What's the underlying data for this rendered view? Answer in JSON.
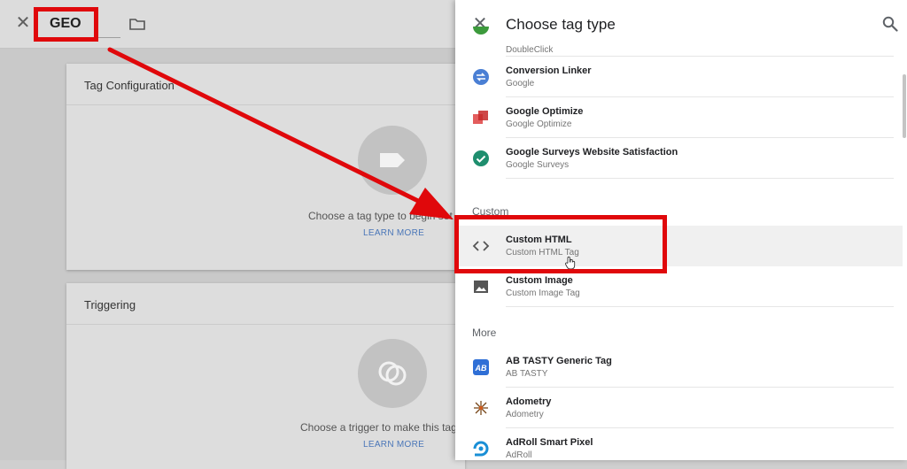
{
  "editor": {
    "tag_name": "GEO",
    "tag_config_title": "Tag Configuration",
    "tag_config_hint": "Choose a tag type to begin set",
    "triggering_title": "Triggering",
    "triggering_hint": "Choose a trigger to make this tag",
    "learn_more": "LEARN MORE"
  },
  "panel": {
    "title": "Choose tag type",
    "items_top": [
      {
        "name": "",
        "sub": "DoubleClick",
        "icon": "doubleclick-icon"
      },
      {
        "name": "Conversion Linker",
        "sub": "Google",
        "icon": "conversion-linker-icon"
      },
      {
        "name": "Google Optimize",
        "sub": "Google Optimize",
        "icon": "google-optimize-icon"
      },
      {
        "name": "Google Surveys Website Satisfaction",
        "sub": "Google Surveys",
        "icon": "google-surveys-icon"
      }
    ],
    "section_custom": "Custom",
    "items_custom": [
      {
        "name": "Custom HTML",
        "sub": "Custom HTML Tag",
        "icon": "code-icon"
      },
      {
        "name": "Custom Image",
        "sub": "Custom Image Tag",
        "icon": "image-icon"
      }
    ],
    "section_more": "More",
    "items_more": [
      {
        "name": "AB TASTY Generic Tag",
        "sub": "AB TASTY",
        "icon": "ab-tasty-icon"
      },
      {
        "name": "Adometry",
        "sub": "Adometry",
        "icon": "adometry-icon"
      },
      {
        "name": "AdRoll Smart Pixel",
        "sub": "AdRoll",
        "icon": "adroll-icon"
      }
    ]
  },
  "colors": {
    "annotation_red": "#e0080b",
    "link_blue": "#4a76b8"
  }
}
